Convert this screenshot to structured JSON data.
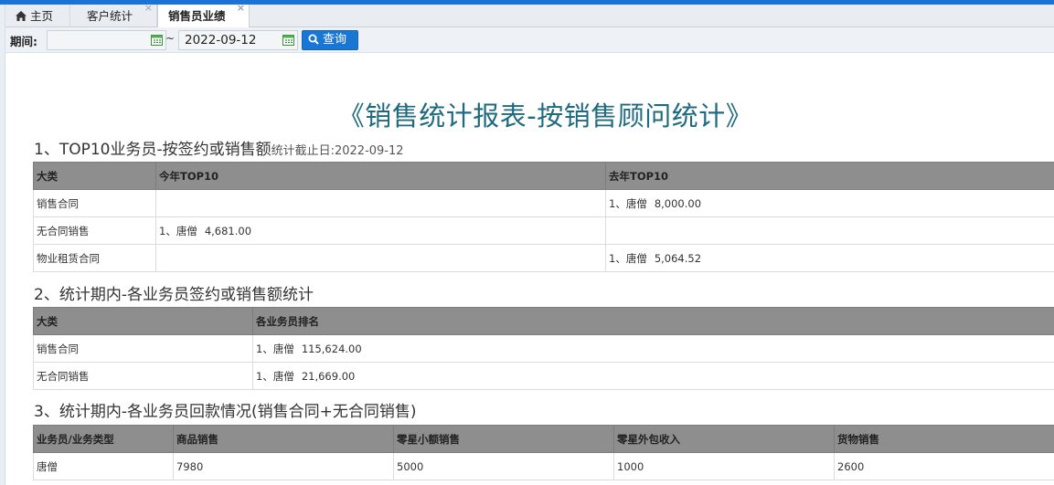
{
  "tabs": [
    {
      "label": "主页",
      "closable": false
    },
    {
      "label": "客户统计",
      "closable": true
    },
    {
      "label": "销售员业绩",
      "closable": true,
      "active": true
    }
  ],
  "close_glyph": "×",
  "filter": {
    "period_label": "期间:",
    "start_date": "",
    "separator": "~",
    "end_date": "2022-09-12",
    "query_label": "查询"
  },
  "report_title": "《销售统计报表-按销售顾问统计》",
  "section1": {
    "title": "1、TOP10业务员-按签约或销售额",
    "cutoff": "统计截止日:2022-09-12",
    "headers": [
      "大类",
      "今年TOP10",
      "去年TOP10"
    ],
    "rows": [
      {
        "category": "销售合同",
        "this_year": "",
        "last_year": {
          "rank": "1、唐僧",
          "amount": "8,000.00"
        }
      },
      {
        "category": "无合同销售",
        "this_year": {
          "rank": "1、唐僧",
          "amount": "4,681.00"
        },
        "last_year": ""
      },
      {
        "category": "物业租赁合同",
        "this_year": "",
        "last_year": {
          "rank": "1、唐僧",
          "amount": "5,064.52"
        }
      }
    ]
  },
  "section2": {
    "title": "2、统计期内-各业务员签约或销售额统计",
    "headers": [
      "大类",
      "各业务员排名"
    ],
    "rows": [
      {
        "category": "销售合同",
        "ranking": {
          "rank": "1、唐僧",
          "amount": "115,624.00"
        }
      },
      {
        "category": "无合同销售",
        "ranking": {
          "rank": "1、唐僧",
          "amount": "21,669.00"
        }
      }
    ]
  },
  "section3": {
    "title": "3、统计期内-各业务员回款情况(销售合同+无合同销售)",
    "headers": [
      "业务员/业务类型",
      "商品销售",
      "零星小额销售",
      "零星外包收入",
      "货物销售"
    ],
    "rows": [
      {
        "name": "唐僧",
        "goods_sales": "7980",
        "small_sales": "5000",
        "outsourcing_income": "1000",
        "cargo_sales": "2600"
      }
    ]
  }
}
